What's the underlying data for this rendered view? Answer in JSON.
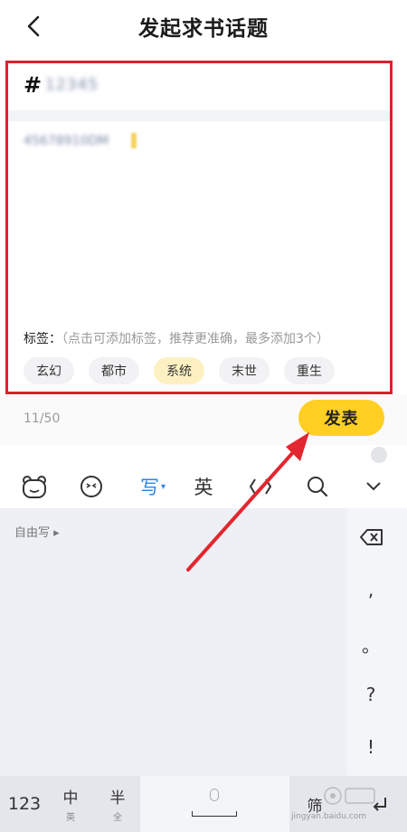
{
  "header": {
    "title": "发起求书话题",
    "back_icon": "chevron-left-icon"
  },
  "editor": {
    "hash": "#",
    "topic_value": "12345",
    "content_value": "45678910DM"
  },
  "tags": {
    "label": "标签：",
    "hint": "（点击可添加标签，推荐更准确，最多添加3个）",
    "items": [
      {
        "label": "玄幻",
        "selected": false
      },
      {
        "label": "都市",
        "selected": false
      },
      {
        "label": "系统",
        "selected": true
      },
      {
        "label": "末世",
        "selected": false
      },
      {
        "label": "重生",
        "selected": false
      }
    ]
  },
  "counter": "11/50",
  "publish_label": "发表",
  "colors": {
    "accent": "#ffcf24",
    "annotation": "#d9232d",
    "selected_tag": "#fdf1c2",
    "keyboard_blue": "#2c86e8"
  },
  "keyboard": {
    "toolbar": {
      "write_label": "写",
      "write_dropdown": "▾",
      "english_label": "英"
    },
    "free_write": "自由写 ▸",
    "punctuation": [
      ",",
      "。",
      "?",
      "!"
    ],
    "bottom": {
      "num_label": "123",
      "chinese_main": "中",
      "chinese_sub": "英",
      "half_main": "半",
      "half_sub": "全",
      "next_label": "筛",
      "watermark_text": "jingyan.baidu.com"
    }
  }
}
